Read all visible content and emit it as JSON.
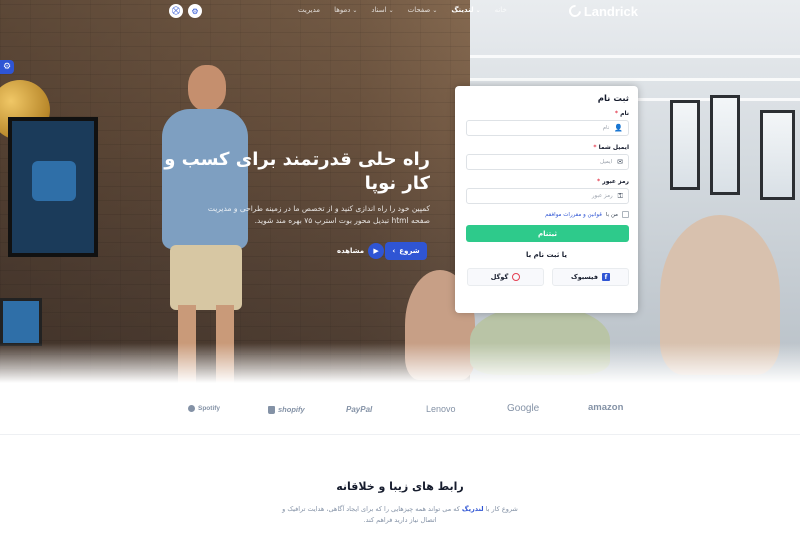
{
  "brand": {
    "name": "Landrick"
  },
  "nav": {
    "items": [
      {
        "label": "خانه",
        "active": false,
        "caret": false
      },
      {
        "label": "لندینگ",
        "active": true,
        "caret": true
      },
      {
        "label": "صفحات",
        "active": false,
        "caret": true
      },
      {
        "label": "اسناد",
        "active": false,
        "caret": true
      },
      {
        "label": "دموها",
        "active": false,
        "caret": true
      },
      {
        "label": "مدیریت",
        "active": false,
        "caret": false
      }
    ],
    "icons": [
      "settings-icon",
      "cart-icon"
    ]
  },
  "hero": {
    "title": "راه حلی قدرتمند برای کسب و کار نوپا",
    "description": "کمپین خود را راه اندازی کنید و از تخصص ما در زمینه طراحی و مدیریت صفحه html تبدیل محور بوت استرپ ۷۵ بهره مند شوید.",
    "start_label": "شروع",
    "watch_label": "مشاهده"
  },
  "signup": {
    "title": "ثبت نام",
    "name_label": "نام",
    "name_placeholder": "نام",
    "email_label": "ایمیل شما",
    "email_placeholder": "ایمیل",
    "password_label": "رمز عبور",
    "password_placeholder": "رمز عبور",
    "terms_prefix": "من با",
    "terms_link": "قوانین و مقررات موافقم",
    "submit_label": "ثبتنام",
    "or_label": "یا ثبت نام با",
    "facebook_label": "فیسبوک",
    "google_label": "گوگل"
  },
  "partners": [
    "Spotify",
    "shopify",
    "PayPal",
    "Lenovo",
    "Google",
    "amazon"
  ],
  "feature": {
    "title": "رابط های زیبا و خلاقانه",
    "desc_prefix": "شروع کار با",
    "desc_highlight": "لندریگ",
    "desc_rest": "که می تواند همه چیزهایی را که برای ایجاد آگاهی، هدایت ترافیک و اتصال نیاز دارید فراهم کند."
  },
  "colors": {
    "primary": "#2f55d4",
    "success": "#2eca8b",
    "danger": "#e43f52",
    "muted": "#8492a6"
  }
}
